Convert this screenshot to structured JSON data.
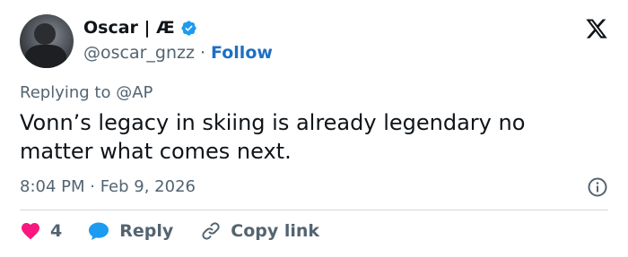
{
  "user": {
    "name": "Oscar | Æ",
    "handle": "@oscar_gnzz",
    "separator": "·",
    "follow_label": "Follow"
  },
  "tweet": {
    "replying_to": "Replying to @AP",
    "text": "Vonn’s legacy in skiing is already legendary no matter what comes next.",
    "timestamp": "8:04 PM · Feb 9, 2026"
  },
  "actions": {
    "like_count": "4",
    "reply_label": "Reply",
    "copy_label": "Copy link"
  },
  "colors": {
    "verified": "#1d9bf0",
    "like": "#f91880",
    "reply": "#1d9bf0",
    "link": "#1d6fc4",
    "text_secondary": "#536471"
  },
  "icons": {
    "verified": "verified-badge-icon",
    "x_logo": "x-logo-icon",
    "info": "info-icon",
    "like": "heart-icon",
    "reply": "speech-bubble-icon",
    "copy": "link-icon"
  }
}
